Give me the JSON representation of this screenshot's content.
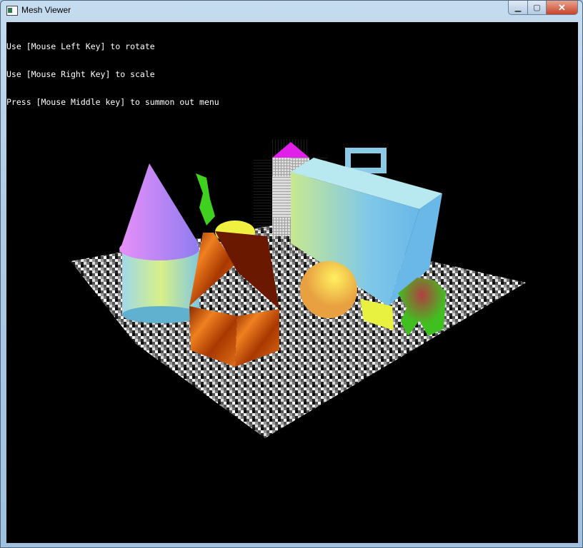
{
  "window": {
    "title": "Mesh Viewer",
    "minimize": "▁",
    "maximize": "▢",
    "close": "✕"
  },
  "help": {
    "lines": [
      "Use [Mouse Left Key] to rotate",
      "Use [Mouse Right Key] to scale",
      "Press [Mouse Middle key] to summon out menu"
    ]
  },
  "colors": {
    "background": "#000000",
    "cone": "#c878f0",
    "house": "#c85a10",
    "sphere": "#f0c840",
    "box": "#8ccbe8",
    "figure": "#30b020"
  }
}
